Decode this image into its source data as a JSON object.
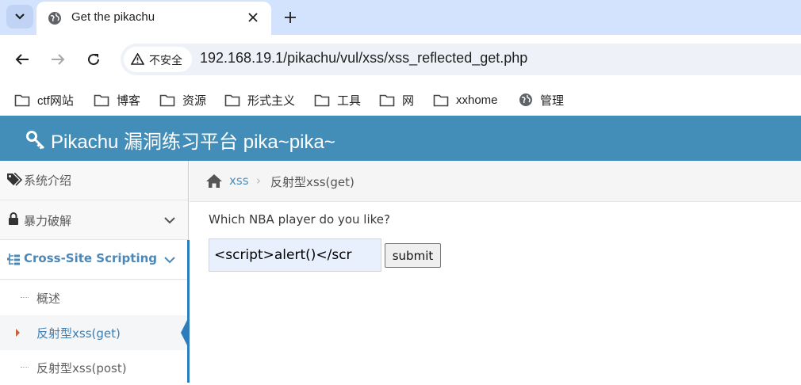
{
  "browser": {
    "tab_title": "Get the pikachu",
    "security_label": "不安全",
    "url": "192.168.19.1/pikachu/vul/xss/xss_reflected_get.php",
    "bookmarks": [
      {
        "label": "ctf网站",
        "icon": "folder-icon"
      },
      {
        "label": "博客",
        "icon": "folder-icon"
      },
      {
        "label": "资源",
        "icon": "folder-icon"
      },
      {
        "label": "形式主义",
        "icon": "folder-icon"
      },
      {
        "label": "工具",
        "icon": "folder-icon"
      },
      {
        "label": "网",
        "icon": "folder-icon"
      },
      {
        "label": "xxhome",
        "icon": "folder-icon"
      },
      {
        "label": "管理",
        "icon": "globe-icon"
      }
    ]
  },
  "header": {
    "title": "Pikachu 漏洞练习平台 pika~pika~",
    "icon": "key-icon",
    "color": "#438eb9"
  },
  "sidebar": {
    "items": [
      {
        "label": "系统介绍",
        "icon": "tags-icon"
      },
      {
        "label": "暴力破解",
        "icon": "lock-icon"
      },
      {
        "label": "Cross-Site Scripting",
        "icon": "sitemap-icon"
      }
    ],
    "sub_items": [
      {
        "label": "概述"
      },
      {
        "label": "反射型xss(get)"
      },
      {
        "label": "反射型xss(post)"
      }
    ]
  },
  "breadcrumb": {
    "link": "xss",
    "current": "反射型xss(get)"
  },
  "main": {
    "question": "Which NBA player do you like?",
    "input_value": "<script>alert()</scr",
    "submit_label": "submit"
  }
}
